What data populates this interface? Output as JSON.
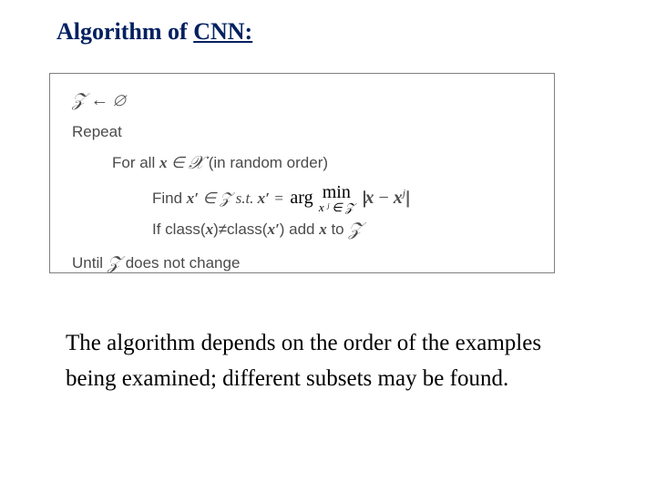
{
  "title": {
    "prefix": "Algorithm of ",
    "underlined": "CNN:"
  },
  "algo": {
    "l1_sym": "𝒵 ← ∅",
    "l2": "Repeat",
    "l3_for": "For all ",
    "l3_x": "x",
    "l3_in": " ∈ ",
    "l3_X": "𝒳",
    "l3_tail": " (in random order)",
    "l4_find": "Find ",
    "l4_xprime": "x′",
    "l4_inZ": " ∈ 𝒵 s.t.  ",
    "l4_xprime2": "x′",
    "l4_eq": " = ",
    "l4_arg": "arg",
    "l4_min": "min",
    "l4_minsub": "x ʲ ∈ 𝒵",
    "l4_norm_open": "||",
    "l4_norm_x": "x",
    "l4_norm_minus": " − ",
    "l4_norm_xj_x": "x",
    "l4_norm_xj_j": "j",
    "l4_norm_close": "||",
    "l5_if": "If class(",
    "l5_x1": "x",
    "l5_ne": ")≠class(",
    "l5_xprime": "x′",
    "l5_add": ") add ",
    "l5_x2": "x",
    "l5_to": " to ",
    "l5_Z": "𝒵",
    "l6_until": "Until ",
    "l6_Z": "𝒵",
    "l6_tail": " does not change"
  },
  "footer": {
    "line1": "The algorithm depends on the order of the examples",
    "line2": "being examined;  different subsets may be found."
  }
}
